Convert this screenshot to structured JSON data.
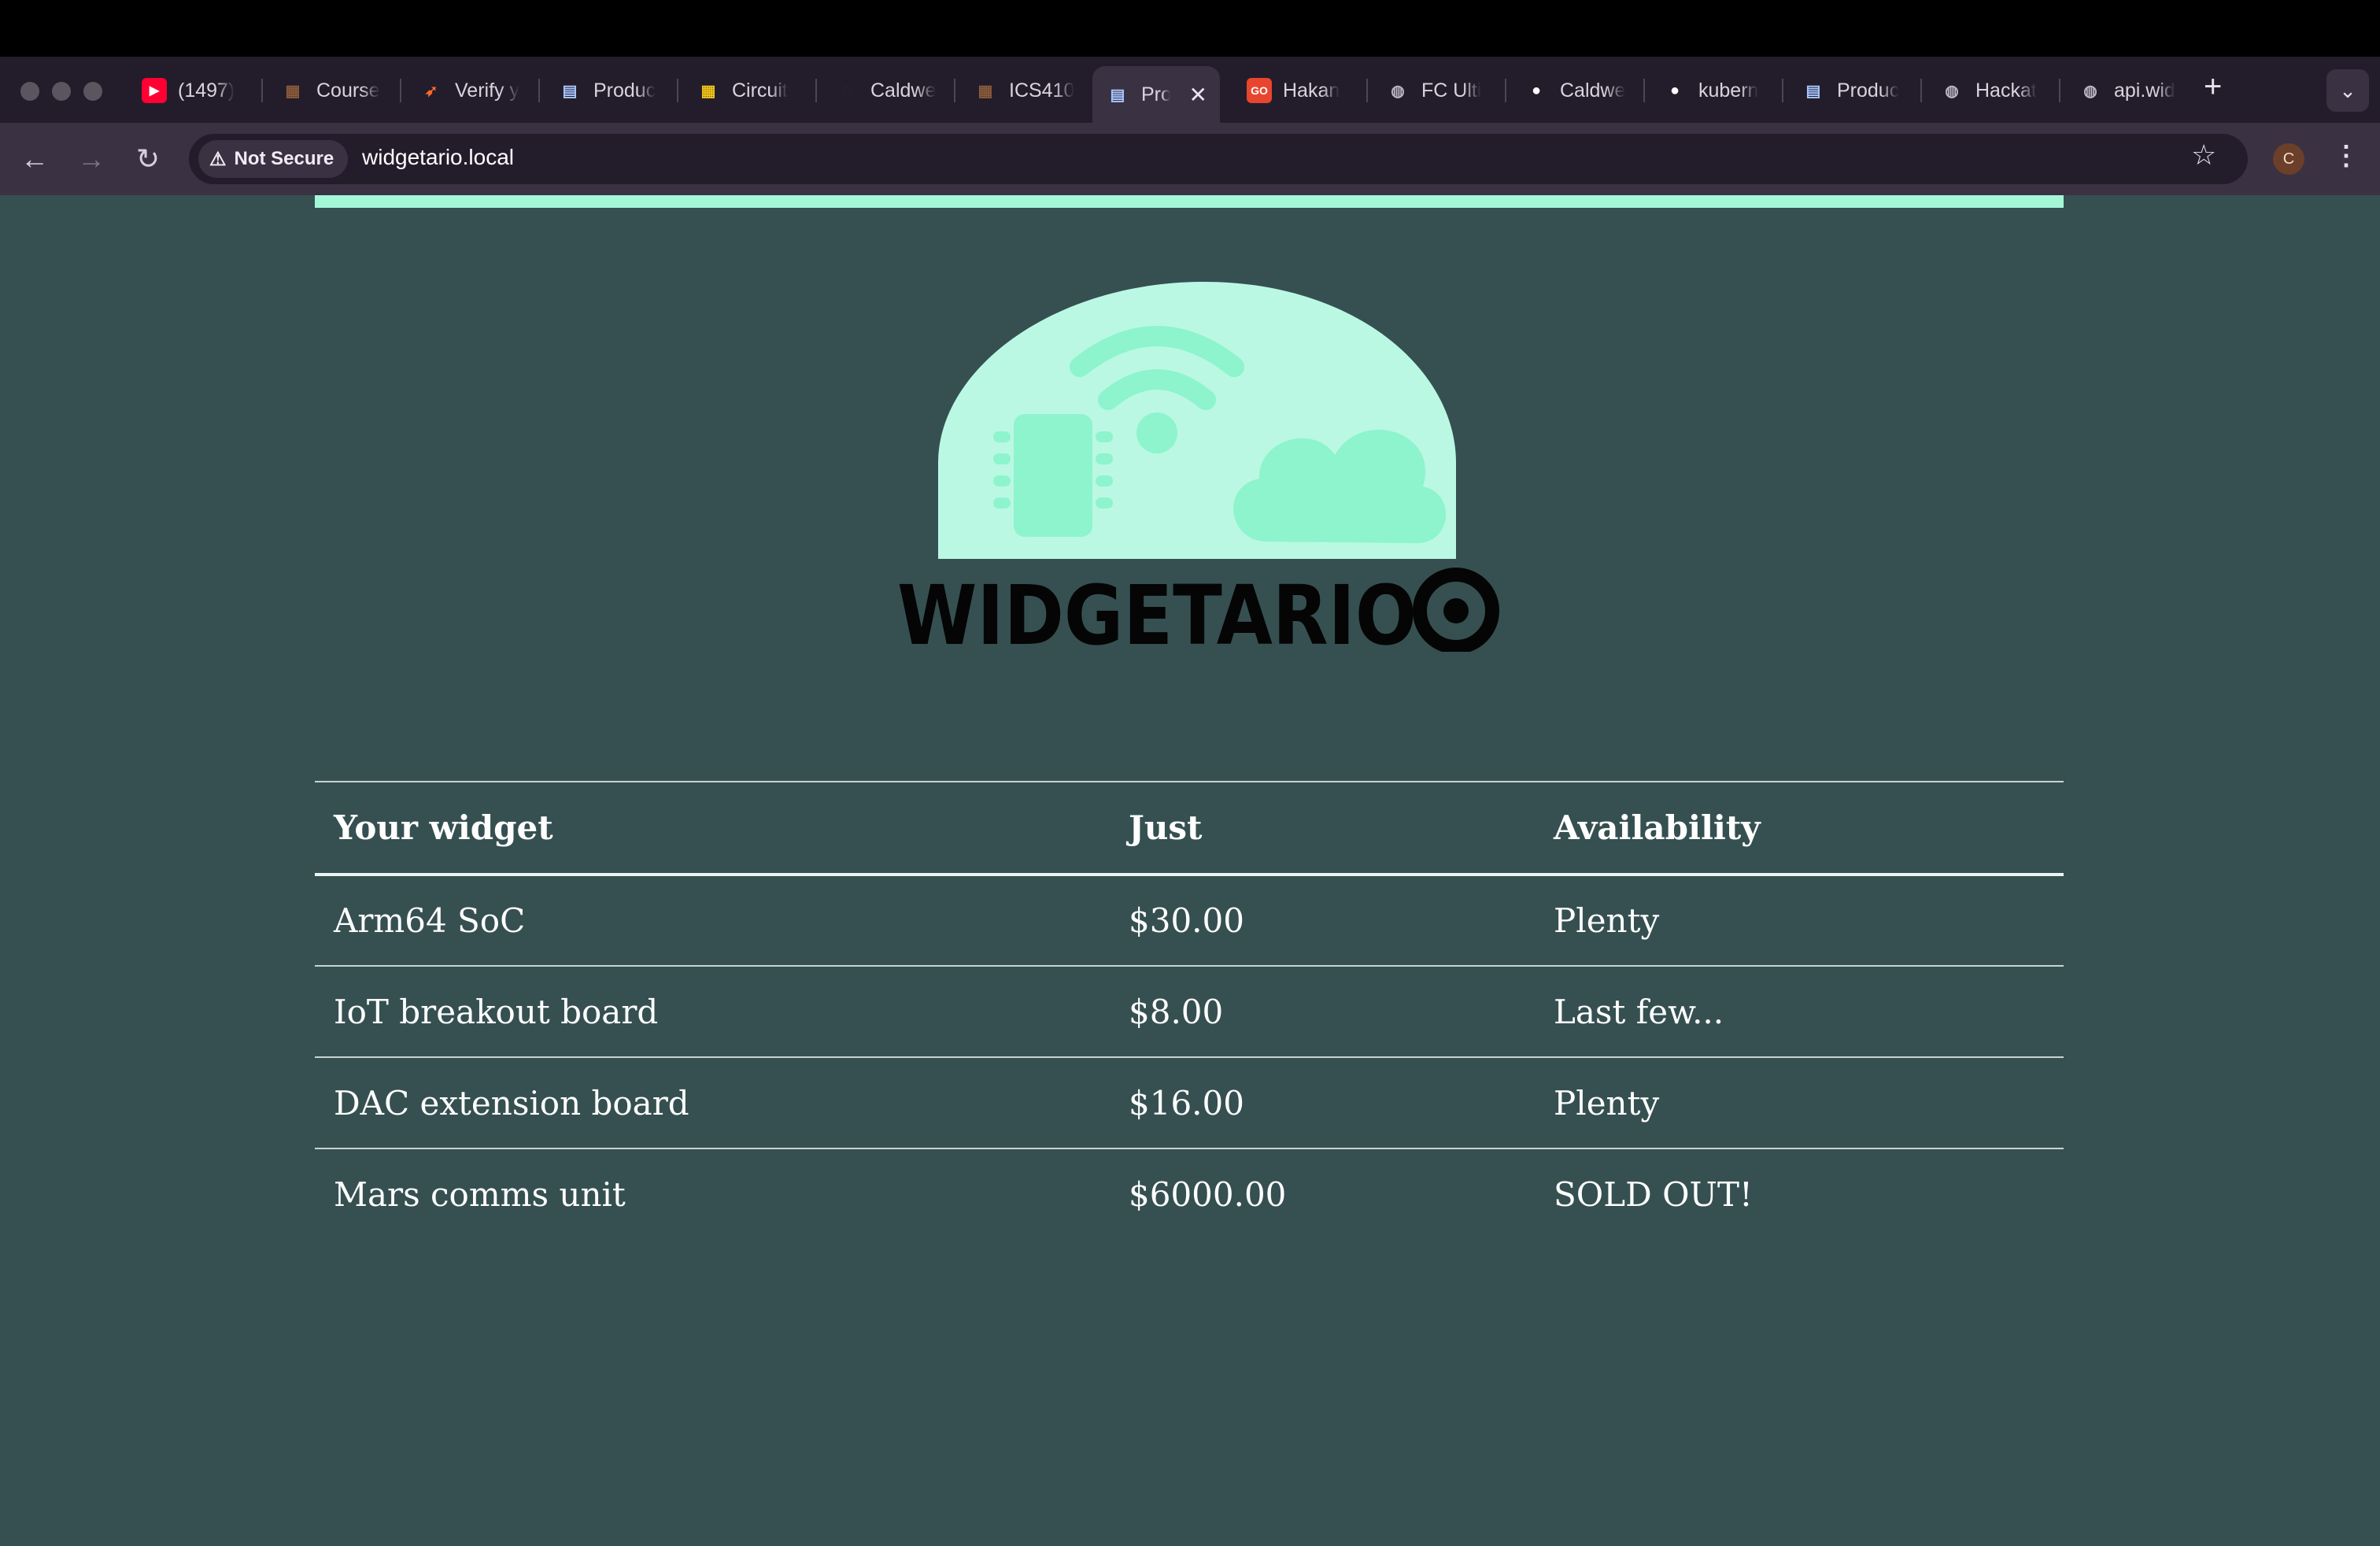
{
  "browser": {
    "tabs": [
      {
        "label": "(1497)",
        "icon": "youtube-icon",
        "color": "#ff0033"
      },
      {
        "label": "Course",
        "icon": "course-favicon",
        "color": "#8a5a3a"
      },
      {
        "label": "Verify y",
        "icon": "verify-favicon",
        "color": "#ff6b2b"
      },
      {
        "label": "Produc",
        "icon": "document-icon",
        "color": "#a9c7ff"
      },
      {
        "label": "Circuit",
        "icon": "circuit-favicon",
        "color": "#f0c419"
      },
      {
        "label": "Caldwe",
        "icon": "caldwell-favicon",
        "color": "#2b2b33"
      },
      {
        "label": "ICS410",
        "icon": "ics-favicon",
        "color": "#8a5a3a"
      },
      {
        "label": "Pro",
        "icon": "document-icon",
        "color": "#a9c7ff",
        "active": true
      },
      {
        "label": "Hakan",
        "icon": "go-favicon",
        "color": "#e8452f"
      },
      {
        "label": "FC Ulti",
        "icon": "globe-icon",
        "color": "#bdb6c4"
      },
      {
        "label": "Caldwe",
        "icon": "github-icon",
        "color": "#ffffff"
      },
      {
        "label": "kubern",
        "icon": "github-icon",
        "color": "#ffffff"
      },
      {
        "label": "Produc",
        "icon": "document-icon",
        "color": "#a9c7ff"
      },
      {
        "label": "Hackat",
        "icon": "globe-icon",
        "color": "#bdb6c4"
      },
      {
        "label": "api.wid",
        "icon": "globe-icon",
        "color": "#bdb6c4"
      }
    ],
    "security_label": "Not Secure",
    "url": "widgetario.local",
    "profile_initial": "C"
  },
  "site": {
    "brand_name": "WIDGETARIO",
    "accent_color": "#a3f7d7",
    "background_color": "#365051"
  },
  "table": {
    "headers": [
      "Your widget",
      "Just",
      "Availability"
    ],
    "rows": [
      [
        "Arm64 SoC",
        "$30.00",
        "Plenty"
      ],
      [
        "IoT breakout board",
        "$8.00",
        "Last few..."
      ],
      [
        "DAC extension board",
        "$16.00",
        "Plenty"
      ],
      [
        "Mars comms unit",
        "$6000.00",
        "SOLD OUT!"
      ]
    ]
  }
}
